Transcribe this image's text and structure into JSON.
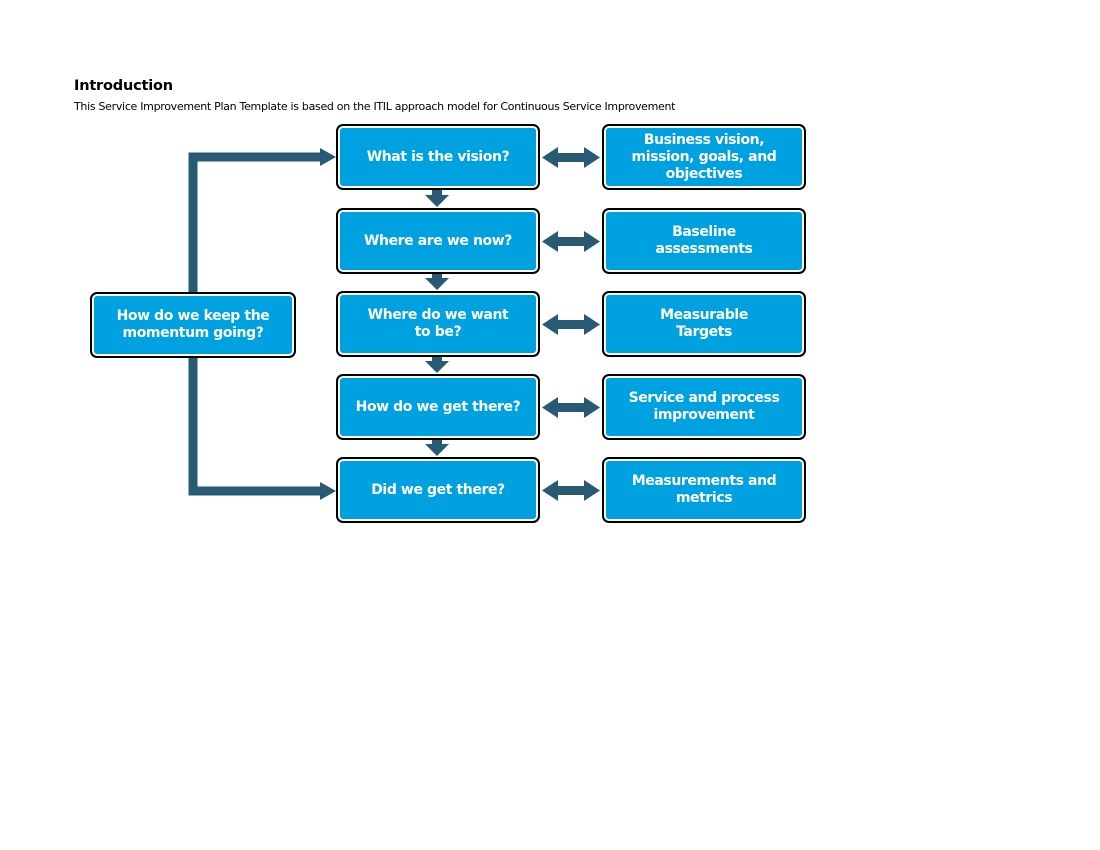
{
  "document": {
    "heading": "Introduction",
    "subtitle": "This Service Improvement Plan Template is based on the ITIL approach model for Continuous Service Improvement"
  },
  "diagram": {
    "connector_color": "#285a73",
    "box_color": "#00a1e0",
    "steps": [
      {
        "question": "What is the vision?",
        "outcome": "Business vision,\nmission, goals, and\nobjectives"
      },
      {
        "question": "Where are we now?",
        "outcome": "Baseline\nassessments"
      },
      {
        "question": "Where do we want\nto be?",
        "outcome": "Measurable\nTargets"
      },
      {
        "question": "How do we get there?",
        "outcome": "Service and process\nimprovement"
      },
      {
        "question": "Did we get there?",
        "outcome": "Measurements and\nmetrics"
      }
    ],
    "loop_box": "How do we keep the\nmomentum going?"
  }
}
